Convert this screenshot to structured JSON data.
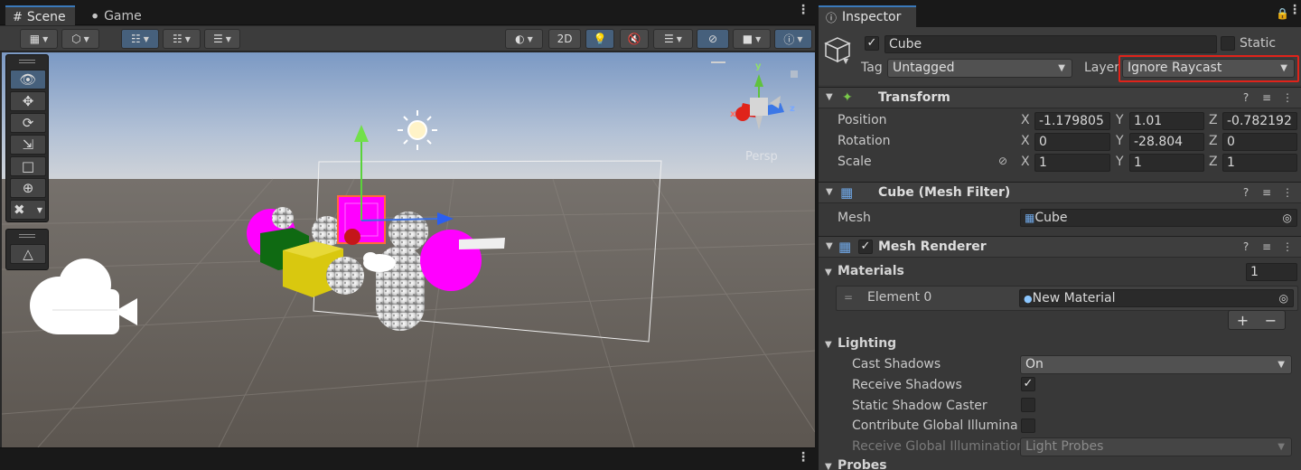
{
  "scene": {
    "tabs": [
      {
        "label": "Scene",
        "icon": "hash-grid-icon"
      },
      {
        "label": "Game",
        "icon": "gamepad-icon"
      }
    ],
    "toolbar": {
      "mode_2d_label": "2D"
    },
    "viewport": {
      "projection_label": "Persp",
      "gizmo_axes": {
        "x": "x",
        "y": "y",
        "z": "z"
      }
    }
  },
  "inspector": {
    "tab_label": "Inspector",
    "object": {
      "name": "Cube",
      "active": true,
      "static_label": "Static",
      "static": false,
      "tag_label": "Tag",
      "tag_value": "Untagged",
      "layer_label": "Layer",
      "layer_value": "Ignore Raycast"
    },
    "transform": {
      "title": "Transform",
      "position": {
        "label": "Position",
        "x": "-1.179805",
        "y": "1.01",
        "z": "-0.782192"
      },
      "rotation": {
        "label": "Rotation",
        "x": "0",
        "y": "-28.804",
        "z": "0"
      },
      "scale": {
        "label": "Scale",
        "x": "1",
        "y": "1",
        "z": "1"
      },
      "axis_labels": {
        "x": "X",
        "y": "Y",
        "z": "Z"
      }
    },
    "mesh_filter": {
      "title": "Cube (Mesh Filter)",
      "mesh_label": "Mesh",
      "mesh_value": "Cube"
    },
    "mesh_renderer": {
      "title": "Mesh Renderer",
      "enabled": true,
      "materials_label": "Materials",
      "materials_count": "1",
      "element0_label": "Element 0",
      "element0_value": "New Material",
      "add_label": "+",
      "remove_label": "−",
      "lighting_label": "Lighting",
      "cast_shadows_label": "Cast Shadows",
      "cast_shadows_value": "On",
      "receive_shadows_label": "Receive Shadows",
      "receive_shadows": true,
      "static_caster_label": "Static Shadow Caster",
      "static_caster": false,
      "contribute_gi_label": "Contribute Global Illuminatio",
      "contribute_gi": false,
      "receive_gi_label": "Receive Global Illumination",
      "receive_gi_value": "Light Probes",
      "probes_label": "Probes"
    }
  },
  "colors": {
    "accent": "#3a79bb",
    "highlight": "#e0231a",
    "magenta": "#ff00ff",
    "yellow": "#d9c80f",
    "green": "#0f6a12"
  }
}
